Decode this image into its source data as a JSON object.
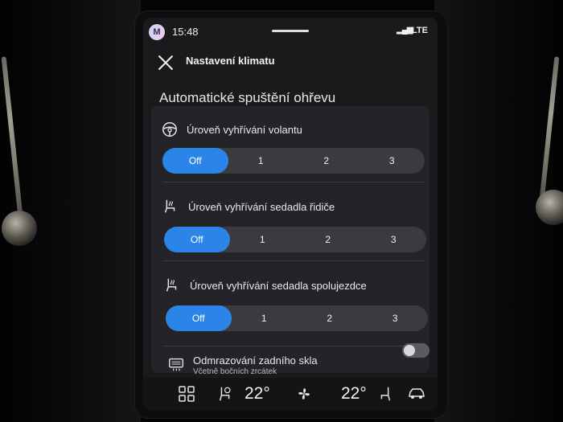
{
  "status_bar": {
    "avatar_initial": "M",
    "time": "15:48",
    "signal": "▂▄▆",
    "network": "LTE"
  },
  "header": {
    "title": "Nastavení klimatu"
  },
  "section": {
    "title": "Automatické spuštění ohřevu"
  },
  "settings": [
    {
      "label": "Úroveň vyhřívání volantu",
      "icon": "steering-wheel-icon",
      "options": [
        "Off",
        "1",
        "2",
        "3"
      ],
      "selected": "Off"
    },
    {
      "label": "Úroveň vyhřívání sedadla řidiče",
      "icon": "heated-seat-icon",
      "options": [
        "Off",
        "1",
        "2",
        "3"
      ],
      "selected": "Off"
    },
    {
      "label": "Úroveň vyhřívání sedadla spolujezdce",
      "icon": "heated-seat-icon",
      "options": [
        "Off",
        "1",
        "2",
        "3"
      ],
      "selected": "Off"
    }
  ],
  "rear_defrost": {
    "label": "Odmrazování zadního skla",
    "sublabel": "Včetně bočních zrcátek",
    "icon": "rear-defrost-icon",
    "enabled": false
  },
  "dock": {
    "left_temp": "22°",
    "right_temp": "22°",
    "icons": [
      "apps-grid-icon",
      "seat-heat-driver-icon",
      "fan-icon",
      "seat-heat-passenger-icon",
      "car-icon"
    ]
  },
  "colors": {
    "accent": "#2b85e8",
    "background": "#1a1a1d",
    "card": "#242428",
    "segment": "#3a3a3f"
  }
}
